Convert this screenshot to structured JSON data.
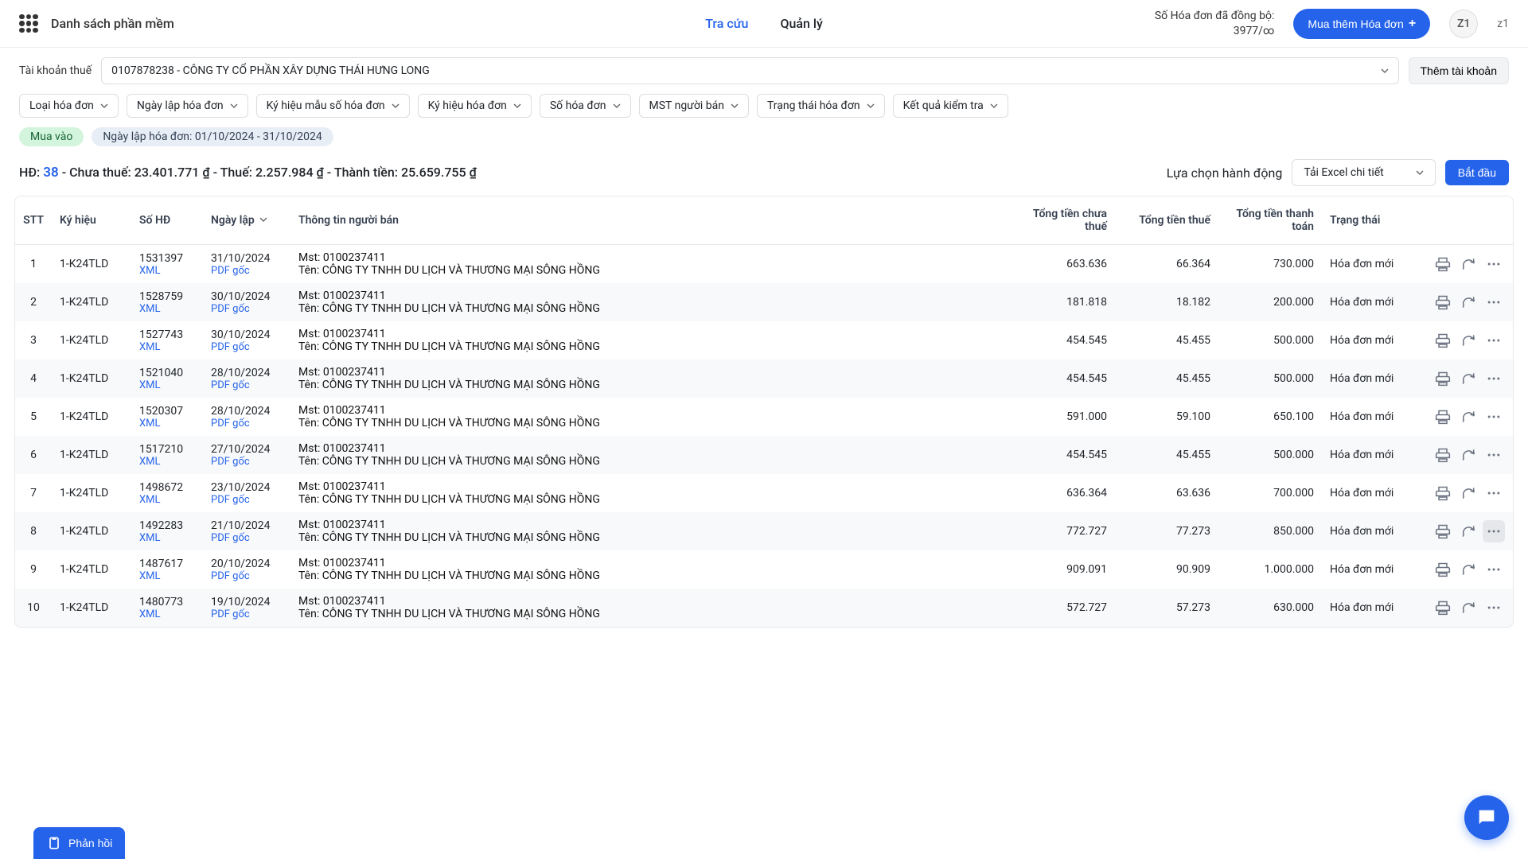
{
  "header": {
    "app_menu_label": "Danh sách phần mềm",
    "tabs": {
      "lookup": "Tra cứu",
      "manage": "Quản lý"
    },
    "sync": {
      "label": "Số Hóa đơn đã đồng bộ:",
      "value": "3977/∞"
    },
    "buy_more": "Mua thêm Hóa đơn",
    "avatar": "Z1",
    "user": "z1"
  },
  "subheader": {
    "tax_account_label": "Tài khoản thuế",
    "account": "0107878238 - CÔNG TY CỔ PHẦN XÂY DỰNG THÁI HƯNG LONG",
    "add_account": "Thêm tài khoản"
  },
  "filters": [
    "Loại hóa đơn",
    "Ngày lập hóa đơn",
    "Ký hiệu mẫu số hóa đơn",
    "Ký hiệu hóa đơn",
    "Số hóa đơn",
    "MST người bán",
    "Trạng thái hóa đơn",
    "Kết quả kiểm tra"
  ],
  "tags": {
    "buy": "Mua vào",
    "range": "Ngày lập hóa đơn: 01/10/2024 - 31/10/2024"
  },
  "summary": {
    "hd_label": "HĐ:",
    "count": "38",
    "pre_tax_lbl": " - Chưa thuế: ",
    "pre_tax": "23.401.771 ₫",
    "tax_lbl": " - Thuế: ",
    "tax": "2.257.984 ₫",
    "total_lbl": " - Thành tiền: ",
    "total": "25.659.755 ₫",
    "action_label": "Lựa chọn hành động",
    "action_value": "Tải Excel chi tiết",
    "start": "Bắt đầu"
  },
  "columns": {
    "stt": "STT",
    "kyhieu": "Ký hiệu",
    "sohd": "Số HĐ",
    "ngay": "Ngày lập",
    "seller": "Thông tin người bán",
    "pretax": "Tổng tiền chưa thuế",
    "taxamt": "Tổng tiền thuế",
    "total": "Tổng tiền thanh toán",
    "status": "Trạng thái"
  },
  "link_labels": {
    "xml": "XML",
    "pdf": "PDF gốc"
  },
  "seller_prefix": {
    "mst": "Mst: ",
    "name": "Tên: "
  },
  "rows": [
    {
      "stt": "1",
      "kh": "1-K24TLD",
      "sohd": "1531397",
      "ngay": "31/10/2024",
      "mst": "0100237411",
      "ten": "CÔNG TY TNHH DU LỊCH VÀ THƯƠNG MẠI SÔNG HỒNG",
      "c1": "663.636",
      "c2": "66.364",
      "c3": "730.000",
      "st": "Hóa đơn mới"
    },
    {
      "stt": "2",
      "kh": "1-K24TLD",
      "sohd": "1528759",
      "ngay": "30/10/2024",
      "mst": "0100237411",
      "ten": "CÔNG TY TNHH DU LỊCH VÀ THƯƠNG MẠI SÔNG HỒNG",
      "c1": "181.818",
      "c2": "18.182",
      "c3": "200.000",
      "st": "Hóa đơn mới"
    },
    {
      "stt": "3",
      "kh": "1-K24TLD",
      "sohd": "1527743",
      "ngay": "30/10/2024",
      "mst": "0100237411",
      "ten": "CÔNG TY TNHH DU LỊCH VÀ THƯƠNG MẠI SÔNG HỒNG",
      "c1": "454.545",
      "c2": "45.455",
      "c3": "500.000",
      "st": "Hóa đơn mới"
    },
    {
      "stt": "4",
      "kh": "1-K24TLD",
      "sohd": "1521040",
      "ngay": "28/10/2024",
      "mst": "0100237411",
      "ten": "CÔNG TY TNHH DU LỊCH VÀ THƯƠNG MẠI SÔNG HỒNG",
      "c1": "454.545",
      "c2": "45.455",
      "c3": "500.000",
      "st": "Hóa đơn mới"
    },
    {
      "stt": "5",
      "kh": "1-K24TLD",
      "sohd": "1520307",
      "ngay": "28/10/2024",
      "mst": "0100237411",
      "ten": "CÔNG TY TNHH DU LỊCH VÀ THƯƠNG MẠI SÔNG HỒNG",
      "c1": "591.000",
      "c2": "59.100",
      "c3": "650.100",
      "st": "Hóa đơn mới"
    },
    {
      "stt": "6",
      "kh": "1-K24TLD",
      "sohd": "1517210",
      "ngay": "27/10/2024",
      "mst": "0100237411",
      "ten": "CÔNG TY TNHH DU LỊCH VÀ THƯƠNG MẠI SÔNG HỒNG",
      "c1": "454.545",
      "c2": "45.455",
      "c3": "500.000",
      "st": "Hóa đơn mới"
    },
    {
      "stt": "7",
      "kh": "1-K24TLD",
      "sohd": "1498672",
      "ngay": "23/10/2024",
      "mst": "0100237411",
      "ten": "CÔNG TY TNHH DU LỊCH VÀ THƯƠNG MẠI SÔNG HỒNG",
      "c1": "636.364",
      "c2": "63.636",
      "c3": "700.000",
      "st": "Hóa đơn mới"
    },
    {
      "stt": "8",
      "kh": "1-K24TLD",
      "sohd": "1492283",
      "ngay": "21/10/2024",
      "mst": "0100237411",
      "ten": "CÔNG TY TNHH DU LỊCH VÀ THƯƠNG MẠI SÔNG HỒNG",
      "c1": "772.727",
      "c2": "77.273",
      "c3": "850.000",
      "st": "Hóa đơn mới",
      "hl": true
    },
    {
      "stt": "9",
      "kh": "1-K24TLD",
      "sohd": "1487617",
      "ngay": "20/10/2024",
      "mst": "0100237411",
      "ten": "CÔNG TY TNHH DU LỊCH VÀ THƯƠNG MẠI SÔNG HỒNG",
      "c1": "909.091",
      "c2": "90.909",
      "c3": "1.000.000",
      "st": "Hóa đơn mới"
    },
    {
      "stt": "10",
      "kh": "1-K24TLD",
      "sohd": "1480773",
      "ngay": "19/10/2024",
      "mst": "0100237411",
      "ten": "CÔNG TY TNHH DU LỊCH VÀ THƯƠNG MẠI SÔNG HỒNG",
      "c1": "572.727",
      "c2": "57.273",
      "c3": "630.000",
      "st": "Hóa đơn mới"
    }
  ],
  "feedback": "Phản hồi"
}
